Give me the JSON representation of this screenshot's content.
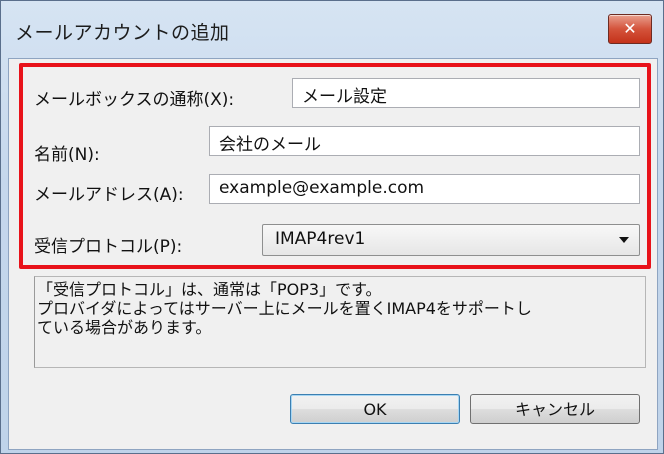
{
  "window": {
    "title": "メールアカウントの追加",
    "close_glyph": "✕"
  },
  "form": {
    "mailbox_label": "メールボックスの通称(X):",
    "mailbox_value": "メール設定",
    "name_label": "名前(N):",
    "name_value": "会社のメール",
    "address_label": "メールアドレス(A):",
    "address_value": "example@example.com",
    "protocol_label": "受信プロトコル(P):",
    "protocol_value": "IMAP4rev1"
  },
  "description": {
    "line1": "「受信プロトコル」は、通常は「POP3」です。",
    "line2": "プロバイダによってはサーバー上にメールを置くIMAP4をサポートし",
    "line3": "ている場合があります。"
  },
  "buttons": {
    "ok": "OK",
    "cancel": "キャンセル"
  },
  "colors": {
    "highlight": "#e8121a",
    "close_button": "#c4321a"
  }
}
